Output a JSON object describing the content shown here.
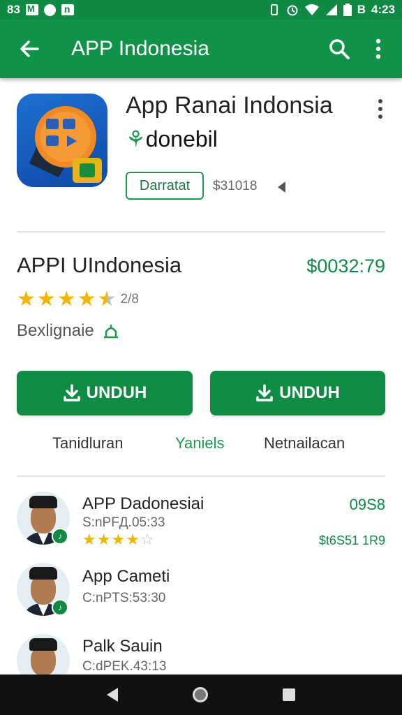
{
  "status_bar": {
    "left_text": "83",
    "time": "4:23",
    "right_prefix": "B"
  },
  "app_bar": {
    "title": "APP Indonesia",
    "back_icon": "arrow-back-icon",
    "search_icon": "search-icon",
    "more_icon": "more-vert-icon"
  },
  "header": {
    "app_name": "App Ranai Indonsia",
    "developer_leaf": "⚘",
    "developer": "donebil",
    "install_chip": "Darratat",
    "price_small": "$31018"
  },
  "info": {
    "title": "APPI UIndonesia",
    "price": "$0032:79",
    "rating_count": "2/8",
    "category": "Bexlignaie",
    "stars_filled": 4,
    "stars_half": true
  },
  "buttons": {
    "download_left": "UNDUH",
    "download_right": "UNDUH"
  },
  "tabs": [
    {
      "label": "Tanidluran"
    },
    {
      "label": "Yaniels"
    },
    {
      "label": "Netnailacan"
    }
  ],
  "list": [
    {
      "name": "APP Dadonesiai",
      "sub": "S:nPFД.05:33",
      "right_top": "09S8",
      "right_bottom": "$t6S51 1R9",
      "stars": 4
    },
    {
      "name": "App Cameti",
      "sub": "C:nPTS:53:30"
    },
    {
      "name": "Palk Sauin",
      "sub": "C:dPEK.43:13"
    }
  ],
  "colors": {
    "primary": "#109249",
    "accent": "#1a9b4b",
    "star": "#f4b400"
  }
}
